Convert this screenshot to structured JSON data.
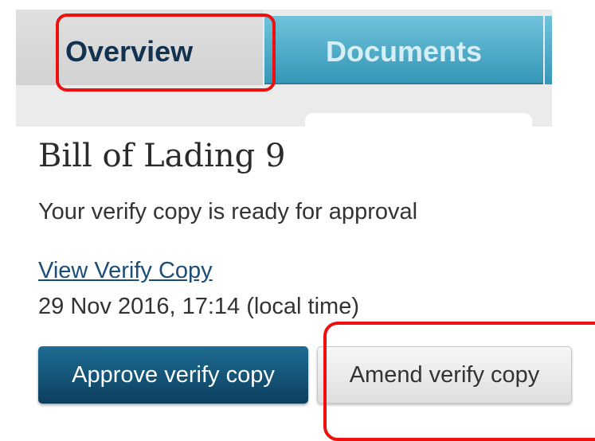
{
  "tabs": {
    "overview_label": "Overview",
    "documents_label": "Documents"
  },
  "main": {
    "title": "Bill of Lading 9",
    "status": "Your verify copy is ready for approval",
    "link_label": "View Verify Copy",
    "timestamp": "29 Nov 2016, 17:14 (local time)"
  },
  "actions": {
    "approve_label": "Approve verify copy",
    "amend_label": "Amend verify copy"
  },
  "colors": {
    "primary_button": "#0d3f5e",
    "active_tab_text": "#12324f",
    "inactive_tab": "#3697b8",
    "annotation": "#ee0f0f"
  }
}
